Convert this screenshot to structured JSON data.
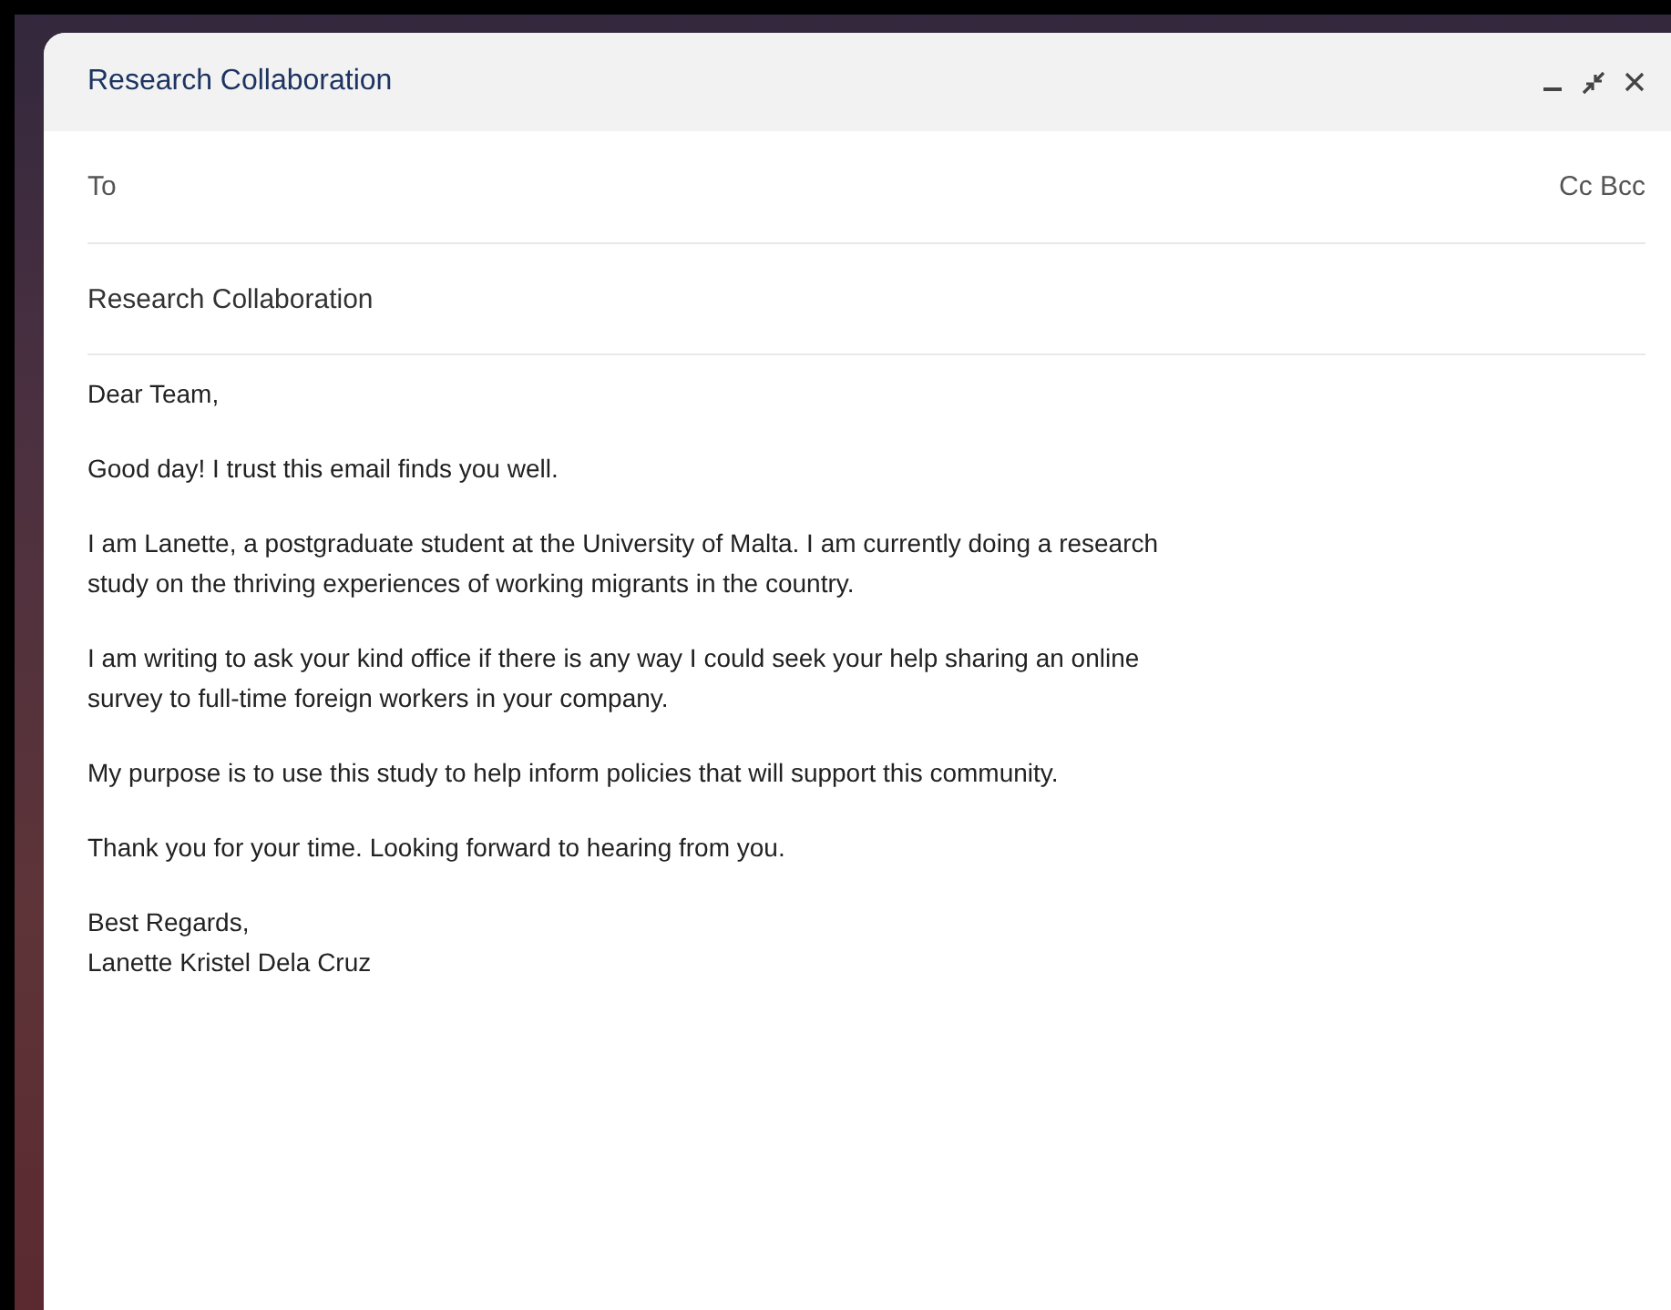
{
  "window": {
    "title": "Research Collaboration"
  },
  "recipients": {
    "label": "To",
    "cc_bcc": "Cc Bcc"
  },
  "subject": "Research Collaboration",
  "body": [
    {
      "lines": [
        "Dear Team,"
      ]
    },
    {
      "lines": [
        "Good day! I trust this email finds you well."
      ]
    },
    {
      "lines": [
        "I am Lanette, a postgraduate student at the University of Malta. I am currently doing a research",
        "study on the thriving experiences of working migrants in the country."
      ]
    },
    {
      "lines": [
        "I am writing to ask your kind office if there is any way I could seek your help sharing an online",
        "survey to full-time foreign workers in your company."
      ]
    },
    {
      "lines": [
        "My purpose is to use this study to help inform policies that will support this community."
      ]
    },
    {
      "lines": [
        "Thank you for your time. Looking forward to hearing from you."
      ]
    },
    {
      "lines": [
        "Best Regards,",
        "Lanette Kristel Dela Cruz"
      ]
    }
  ]
}
